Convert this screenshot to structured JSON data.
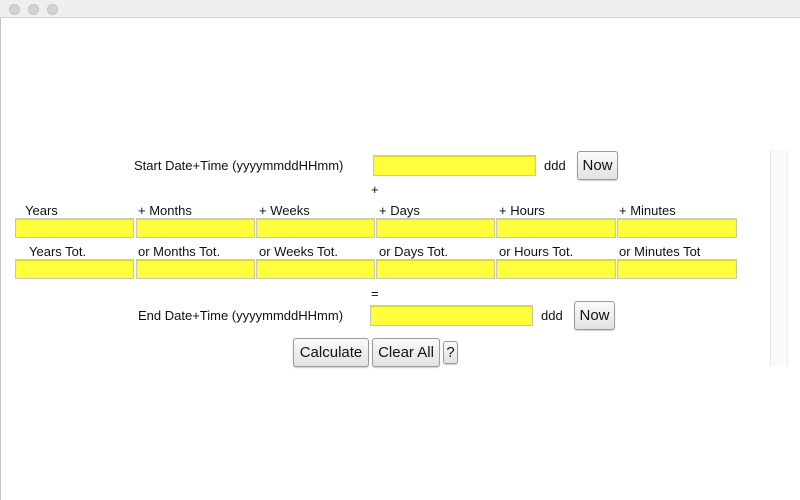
{
  "window": {
    "controls": [
      "close",
      "minimize",
      "zoom"
    ]
  },
  "start": {
    "label": "Start Date+Time (yyyymmddHHmm)",
    "value": "",
    "day_label": "ddd",
    "now_button": "Now"
  },
  "plus_sign": "+",
  "increments": {
    "labels": [
      "Years",
      "+ Months",
      "+ Weeks",
      "+ Days",
      "+ Hours",
      "+ Minutes"
    ],
    "values": [
      "",
      "",
      "",
      "",
      "",
      ""
    ]
  },
  "totals": {
    "labels": [
      "Years Tot.",
      "or Months Tot.",
      "or Weeks Tot.",
      "or Days Tot.",
      "or Hours Tot.",
      "or Minutes Tot"
    ],
    "values": [
      "",
      "",
      "",
      "",
      "",
      ""
    ]
  },
  "equals_sign": "=",
  "end": {
    "label": "End Date+Time (yyyymmddHHmm)",
    "value": "",
    "day_label": "ddd",
    "now_button": "Now"
  },
  "actions": {
    "calculate": "Calculate",
    "clear_all": "Clear All",
    "help": "?"
  },
  "colors": {
    "field_bg": "#ffff3c"
  }
}
